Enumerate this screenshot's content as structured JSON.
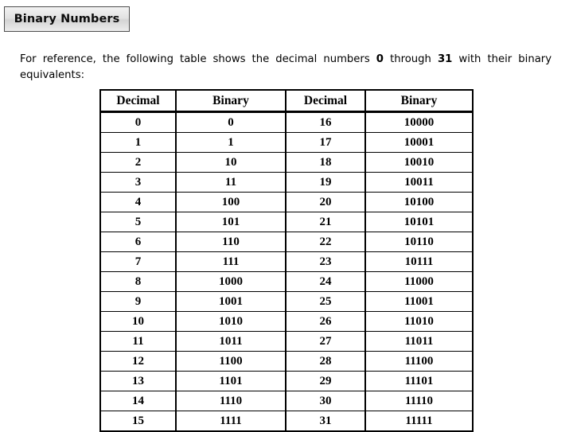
{
  "slide": {
    "title": "Binary Numbers",
    "intro_before": "For reference, the following table shows the decimal numbers ",
    "intro_num_start": "0",
    "intro_middle": " through ",
    "intro_num_end": "31",
    "intro_after": " with their binary equivalents:"
  },
  "table": {
    "headers": [
      "Decimal",
      "Binary",
      "Decimal",
      "Binary"
    ],
    "rows": [
      [
        "0",
        "0",
        "16",
        "10000"
      ],
      [
        "1",
        "1",
        "17",
        "10001"
      ],
      [
        "2",
        "10",
        "18",
        "10010"
      ],
      [
        "3",
        "11",
        "19",
        "10011"
      ],
      [
        "4",
        "100",
        "20",
        "10100"
      ],
      [
        "5",
        "101",
        "21",
        "10101"
      ],
      [
        "6",
        "110",
        "22",
        "10110"
      ],
      [
        "7",
        "111",
        "23",
        "10111"
      ],
      [
        "8",
        "1000",
        "24",
        "11000"
      ],
      [
        "9",
        "1001",
        "25",
        "11001"
      ],
      [
        "10",
        "1010",
        "26",
        "11010"
      ],
      [
        "11",
        "1011",
        "27",
        "11011"
      ],
      [
        "12",
        "1100",
        "28",
        "11100"
      ],
      [
        "13",
        "1101",
        "29",
        "11101"
      ],
      [
        "14",
        "1110",
        "30",
        "11110"
      ],
      [
        "15",
        "1111",
        "31",
        "11111"
      ]
    ]
  },
  "colors": {
    "page_background": "#ffffff",
    "text": "#000000",
    "table_border": "#000000",
    "title_border": "#4d4d4d",
    "title_fill_top": "#f2f2f2",
    "title_fill_bottom": "#ececec"
  }
}
